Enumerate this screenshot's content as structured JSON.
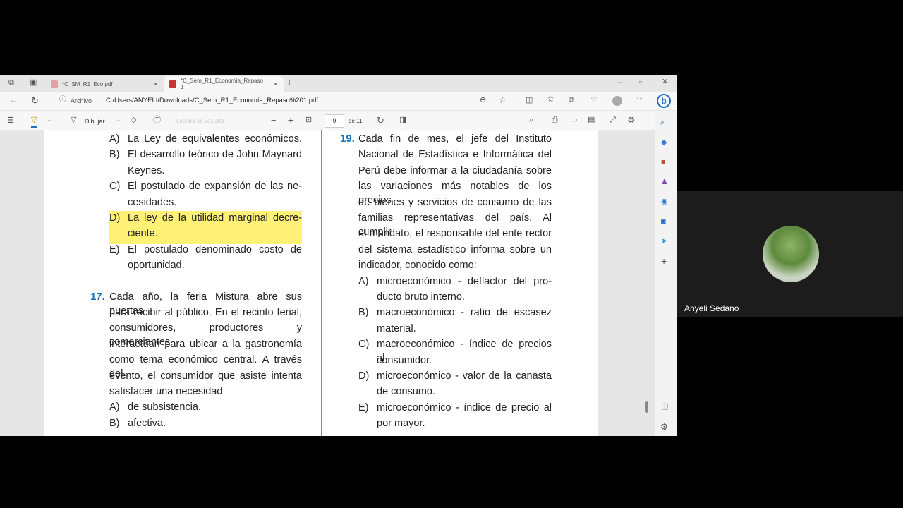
{
  "browser": {
    "tabs": [
      {
        "label": "*C_SM_R1_Eco.pdf",
        "active": false
      },
      {
        "label": "*C_Sem_R1_Economía_Repaso 1",
        "active": true
      }
    ],
    "address_label": "Archivo",
    "url": "C:/Users/ANYELI/Downloads/C_Sem_R1_Economía_Repaso%201.pdf"
  },
  "pdf_toolbar": {
    "draw_label": "Dibujar",
    "read_aloud_label": "Lectura en voz alta",
    "page_current": "9",
    "page_total": "de 11"
  },
  "left_column": {
    "q16_options": [
      {
        "lines": [
          "A)",
          "La Ley de equivalentes económicos."
        ]
      },
      {
        "lines": [
          "B)",
          "El desarrollo teórico de John Maynard",
          "Keynes."
        ]
      },
      {
        "lines": [
          "C)",
          "El postulado de expansión de las ne-",
          "cesidades."
        ]
      },
      {
        "lines": [
          "D)",
          "La ley de la utilidad marginal decre-",
          "ciente."
        ],
        "highlighted": true
      },
      {
        "lines": [
          "E)",
          "El postulado denominado costo de",
          "oportunidad."
        ]
      }
    ],
    "q17": {
      "number": "17.",
      "lines": [
        "Cada año, la feria Mistura abre sus puertas",
        "para recibir al público. En el recinto ferial,",
        "consumidores, productores y comerciantes",
        "interactúan para ubicar a la gastronomía",
        "como tema económico central. A través del",
        "evento, el consumidor que asiste intenta",
        "satisfacer una necesidad"
      ],
      "options": [
        {
          "letter": "A)",
          "text": "de subsistencia."
        },
        {
          "letter": "B)",
          "text": "afectiva."
        }
      ]
    }
  },
  "right_column": {
    "q19": {
      "number": "19.",
      "lines": [
        "Cada fin de mes, el jefe del Instituto",
        "Nacional de Estadística e Informática del",
        "Perú debe informar a la ciudadanía sobre",
        "las variaciones más notables de los precios",
        "de bienes y servicios de consumo de las",
        "familias representativas del país. Al cumplir",
        "el mandato, el responsable del ente rector",
        "del sistema estadístico informa sobre un",
        "indicador, conocido como:"
      ],
      "options": [
        {
          "letter": "A)",
          "lines": [
            "microeconómico - deflactor del pro-",
            "ducto bruto interno."
          ]
        },
        {
          "letter": "B)",
          "lines": [
            "macroeconómico - ratio de escasez",
            "material."
          ]
        },
        {
          "letter": "C)",
          "lines": [
            "macroeconómico - índice de precios al",
            "consumidor."
          ]
        },
        {
          "letter": "D)",
          "lines": [
            "microeconómico - valor de la canasta",
            "de consumo."
          ]
        },
        {
          "letter": "E)",
          "lines": [
            "microeconómico - índice de precio al",
            "por mayor."
          ]
        }
      ]
    }
  },
  "video": {
    "participant_name": "Anyeli Sedano"
  },
  "colors": {
    "highlight": "#fff176",
    "question_number": "#1a73b8"
  }
}
